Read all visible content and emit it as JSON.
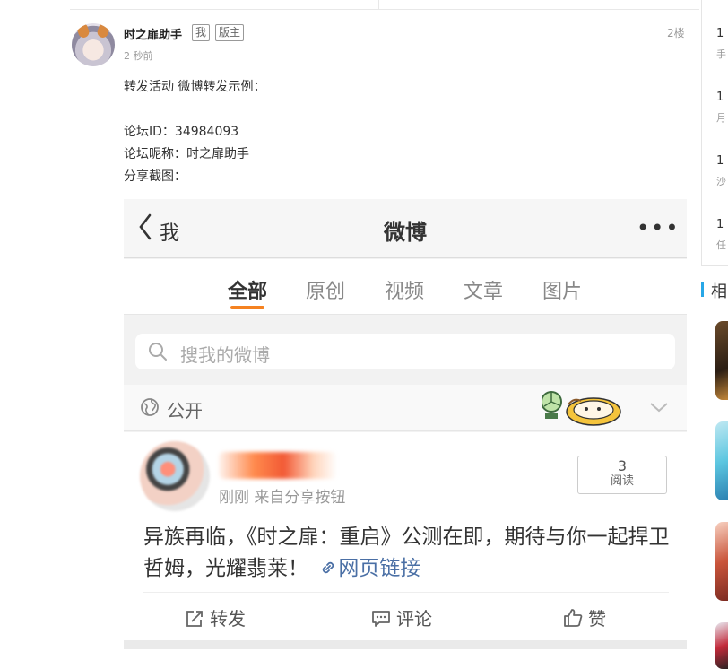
{
  "post": {
    "username": "时之扉助手",
    "tag_me": "我",
    "tag_moderator": "版主",
    "time": "2 秒前",
    "floor": "2楼",
    "lines": [
      "转发活动 微博转发示例：",
      "论坛ID：34984093",
      "论坛昵称：时之扉助手",
      "分享截图："
    ]
  },
  "screenshot": {
    "nav": {
      "back_label": "我",
      "title": "微博",
      "more": "•••"
    },
    "tabs": [
      {
        "label": "全部",
        "active": true
      },
      {
        "label": "原创",
        "active": false
      },
      {
        "label": "视频",
        "active": false
      },
      {
        "label": "文章",
        "active": false
      },
      {
        "label": "图片",
        "active": false
      }
    ],
    "search_placeholder": "搜我的微博",
    "visibility": "公开",
    "feed": {
      "meta": "刚刚  来自分享按钮",
      "reads_count": "3",
      "reads_label": "阅读",
      "text": "异族再临，《时之扉：重启》公测在即，期待与你一起捍卫哲姆，光耀翡莱！",
      "link": "网页链接",
      "actions": {
        "repost": "转发",
        "comment": "评论",
        "like": "赞"
      }
    }
  },
  "sidebar": {
    "items": [
      {
        "num": "1",
        "sub": "手"
      },
      {
        "num": "1",
        "sub": "月"
      },
      {
        "num": "1",
        "sub": "沙"
      },
      {
        "num": "1",
        "sub": "任"
      }
    ],
    "heading": "相"
  },
  "colors": {
    "tab_accent": "#f58220",
    "link": "#4a6fa5",
    "sidebar_accent": "#27a7e7"
  }
}
